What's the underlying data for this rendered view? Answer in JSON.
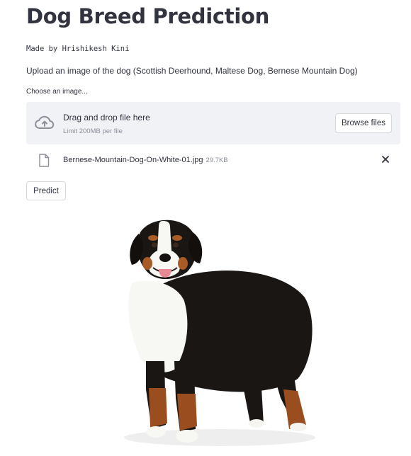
{
  "app": {
    "title": "Dog Breed Prediction",
    "byline": "Made by Hrishikesh Kini",
    "instructions": "Upload an image of the dog (Scottish Deerhound, Maltese Dog, Bernese Mountain Dog)"
  },
  "uploader": {
    "label": "Choose an image...",
    "drop_text": "Drag and drop file here",
    "limit_text": "Limit 200MB per file",
    "browse_label": "Browse files",
    "icon": "cloud-upload-icon"
  },
  "uploaded_file": {
    "name": "Bernese-Mountain-Dog-On-White-01.jpg",
    "size": "29.7KB",
    "icon": "file-icon"
  },
  "actions": {
    "predict_label": "Predict"
  },
  "image": {
    "subject": "Bernese Mountain Dog"
  },
  "colors": {
    "dropzone_bg": "#f0f2f6",
    "text": "#31333f",
    "muted": "#8c8f99",
    "border": "#d5d8de"
  }
}
